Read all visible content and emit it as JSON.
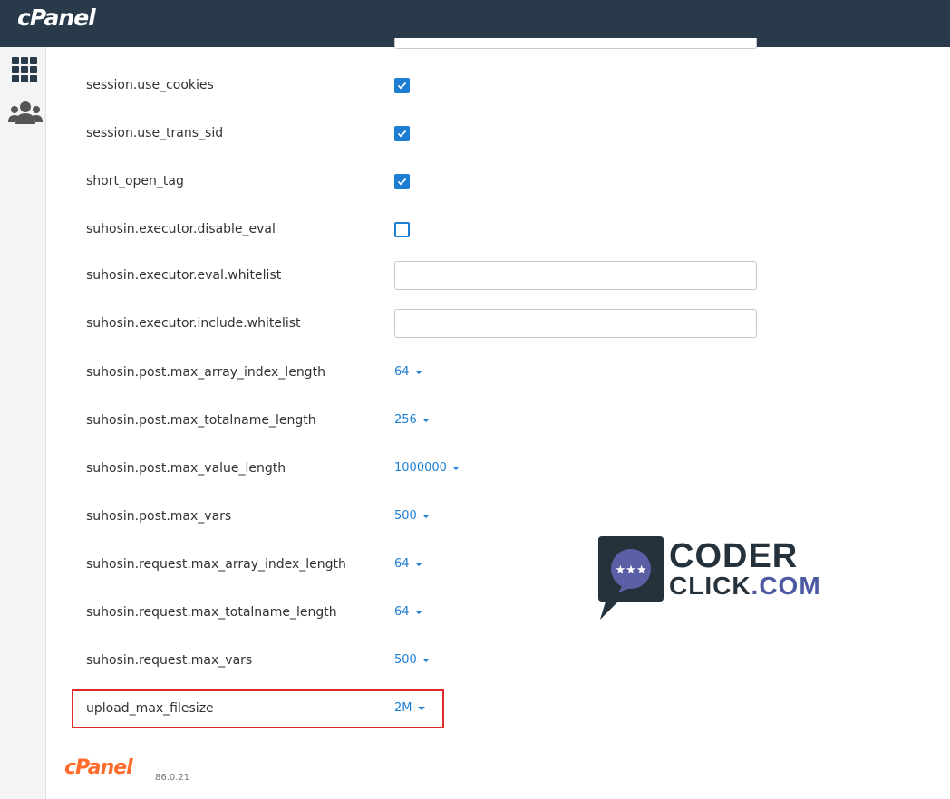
{
  "header": {
    "brand": "cPanel"
  },
  "sidebar": {
    "icons": [
      "grid-icon",
      "users-icon"
    ]
  },
  "rows": [
    {
      "label": "session.use_cookies",
      "type": "checkbox",
      "checked": true
    },
    {
      "label": "session.use_trans_sid",
      "type": "checkbox",
      "checked": true
    },
    {
      "label": "short_open_tag",
      "type": "checkbox",
      "checked": true
    },
    {
      "label": "suhosin.executor.disable_eval",
      "type": "checkbox",
      "checked": false
    },
    {
      "label": "suhosin.executor.eval.whitelist",
      "type": "text",
      "value": ""
    },
    {
      "label": "suhosin.executor.include.whitelist",
      "type": "text",
      "value": ""
    },
    {
      "label": "suhosin.post.max_array_index_length",
      "type": "select",
      "value": "64"
    },
    {
      "label": "suhosin.post.max_totalname_length",
      "type": "select",
      "value": "256"
    },
    {
      "label": "suhosin.post.max_value_length",
      "type": "select",
      "value": "1000000"
    },
    {
      "label": "suhosin.post.max_vars",
      "type": "select",
      "value": "500"
    },
    {
      "label": "suhosin.request.max_array_index_length",
      "type": "select",
      "value": "64"
    },
    {
      "label": "suhosin.request.max_totalname_length",
      "type": "select",
      "value": "64"
    },
    {
      "label": "suhosin.request.max_vars",
      "type": "select",
      "value": "500"
    },
    {
      "label": "upload_max_filesize",
      "type": "select",
      "value": "2M",
      "highlighted": true
    }
  ],
  "watermark": {
    "line1": "CODER",
    "line2a": "CLICK",
    "line2b": ".COM"
  },
  "footer": {
    "logo": "cPanel",
    "version": "86.0.21"
  },
  "colors": {
    "header_bg": "#293a4a",
    "accent": "#1b7ed3",
    "highlight": "#dd2a2a",
    "footer_logo": "#ff6c2c"
  }
}
